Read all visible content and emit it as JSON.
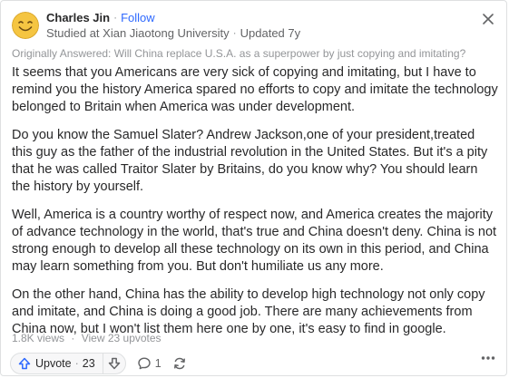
{
  "header": {
    "author_name": "Charles Jin",
    "follow_label": "Follow",
    "credential": "Studied at Xian Jiaotong University",
    "updated": "Updated 7y"
  },
  "original_question": "Originally Answered: Will China replace U.S.A. as a superpower by just copying and imitating?",
  "paragraphs": [
    "It seems that you Americans are very sick of copying and imitating, but I have to remind you the history America spared no efforts to copy and imitate the technology belonged to Britain when America was under development.",
    "Do you know the Samuel Slater? Andrew Jackson,one of your president,treated this guy as the father of the industrial revolution in the United States. But it's a pity that he was called Traitor Slater by Britains, do you know why? You should learn the history by yourself.",
    "Well, America is a country worthy of respect now, and America creates the majority of advance technology in the world, that's true and China doesn't deny. China is not strong enough to develop all these technology on its own in this period, and China may learn something from you. But don't humiliate us any more.",
    "On the other hand, China has the ability to develop high technology not only copy and imitate, and China is doing a good job. There are many achievements from China now, but I won't list them here one by one, it's easy to find in google."
  ],
  "stats": {
    "views": "1.8K views",
    "upvotes": "View 23 upvotes"
  },
  "actions": {
    "upvote_label": "Upvote",
    "upvote_count": "23",
    "comment_count": "1"
  },
  "icons": {
    "avatar": "smiley-face-avatar",
    "close": "close-icon",
    "upvote": "upvote-arrow-icon",
    "downvote": "downvote-arrow-icon",
    "comment": "comment-bubble-icon",
    "share": "share-cycle-icon",
    "more": "more-dots-icon"
  },
  "colors": {
    "accent": "#2e69ff",
    "text": "#282829",
    "muted": "#939598",
    "avatar_yellow": "#f5c542"
  }
}
